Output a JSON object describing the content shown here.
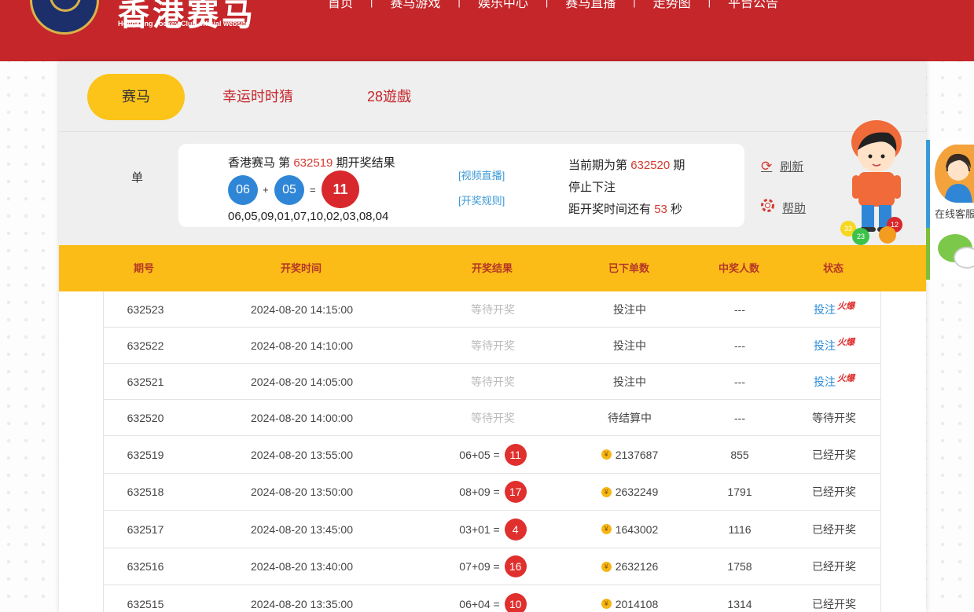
{
  "header": {
    "brand_title": "香港赛马",
    "brand_subtitle": "Hongkong Jockey Club official website",
    "nav": [
      "首页",
      "赛马游戏",
      "娱乐中心",
      "赛马直播",
      "走势图",
      "平台公告"
    ]
  },
  "tabs": [
    {
      "label": "赛马",
      "active": true
    },
    {
      "label": "幸运时时猜",
      "active": false
    },
    {
      "label": "28遊戲",
      "active": false
    }
  ],
  "single_label": "单",
  "last_result": {
    "prefix": "香港赛马 第",
    "period": "632519",
    "suffix": "期开奖结果",
    "ball1": "06",
    "plus": "+",
    "ball2": "05",
    "equals": "=",
    "sum": "11",
    "numbers": "06,05,09,01,07,10,02,03,08,04",
    "video_link": "[视频直播]",
    "rules_link": "[开奖规则]"
  },
  "current": {
    "prefix": "当前期为第",
    "period": "632520",
    "suffix": "期",
    "status": "停止下注",
    "countdown_prefix": "距开奖时间还有",
    "countdown": "53",
    "countdown_suffix": "秒"
  },
  "actions": {
    "refresh": "刷新",
    "help": "帮助"
  },
  "mascot_balls": [
    "33",
    "12",
    "23"
  ],
  "table": {
    "headers": [
      "期号",
      "开奖时间",
      "开奖结果",
      "已下单数",
      "中奖人数",
      "状态"
    ],
    "rows": [
      {
        "period": "632523",
        "time": "2024-08-20 14:15:00",
        "result": "等待开奖",
        "orders": "投注中",
        "winners": "---",
        "status": "投注",
        "hot": "火爆"
      },
      {
        "period": "632522",
        "time": "2024-08-20 14:10:00",
        "result": "等待开奖",
        "orders": "投注中",
        "winners": "---",
        "status": "投注",
        "hot": "火爆"
      },
      {
        "period": "632521",
        "time": "2024-08-20 14:05:00",
        "result": "等待开奖",
        "orders": "投注中",
        "winners": "---",
        "status": "投注",
        "hot": "火爆"
      },
      {
        "period": "632520",
        "time": "2024-08-20 14:00:00",
        "result": "等待开奖",
        "orders": "待结算中",
        "winners": "---",
        "status": "等待开奖"
      },
      {
        "period": "632519",
        "time": "2024-08-20 13:55:00",
        "formula": "06+05 =",
        "sum": "11",
        "orders": "2137687",
        "winners": "855",
        "status": "已经开奖"
      },
      {
        "period": "632518",
        "time": "2024-08-20 13:50:00",
        "formula": "08+09 =",
        "sum": "17",
        "orders": "2632249",
        "winners": "1791",
        "status": "已经开奖"
      },
      {
        "period": "632517",
        "time": "2024-08-20 13:45:00",
        "formula": "03+01 =",
        "sum": "4",
        "orders": "1643002",
        "winners": "1116",
        "status": "已经开奖"
      },
      {
        "period": "632516",
        "time": "2024-08-20 13:40:00",
        "formula": "07+09 =",
        "sum": "16",
        "orders": "2632126",
        "winners": "1758",
        "status": "已经开奖"
      },
      {
        "period": "632515",
        "time": "2024-08-20 13:35:00",
        "formula": "06+04 =",
        "sum": "10",
        "orders": "2014108",
        "winners": "1314",
        "status": "已经开奖"
      }
    ]
  },
  "coin_symbol": "¥",
  "side_widgets": {
    "customer_service": "在线客服"
  },
  "colors": {
    "header_red": "#c4262a",
    "tab_yellow": "#fcc419",
    "table_header": "#fcbc18",
    "ball_blue": "#2f86d6",
    "ball_red": "#e0302e",
    "link_blue": "#2a8bd9"
  }
}
